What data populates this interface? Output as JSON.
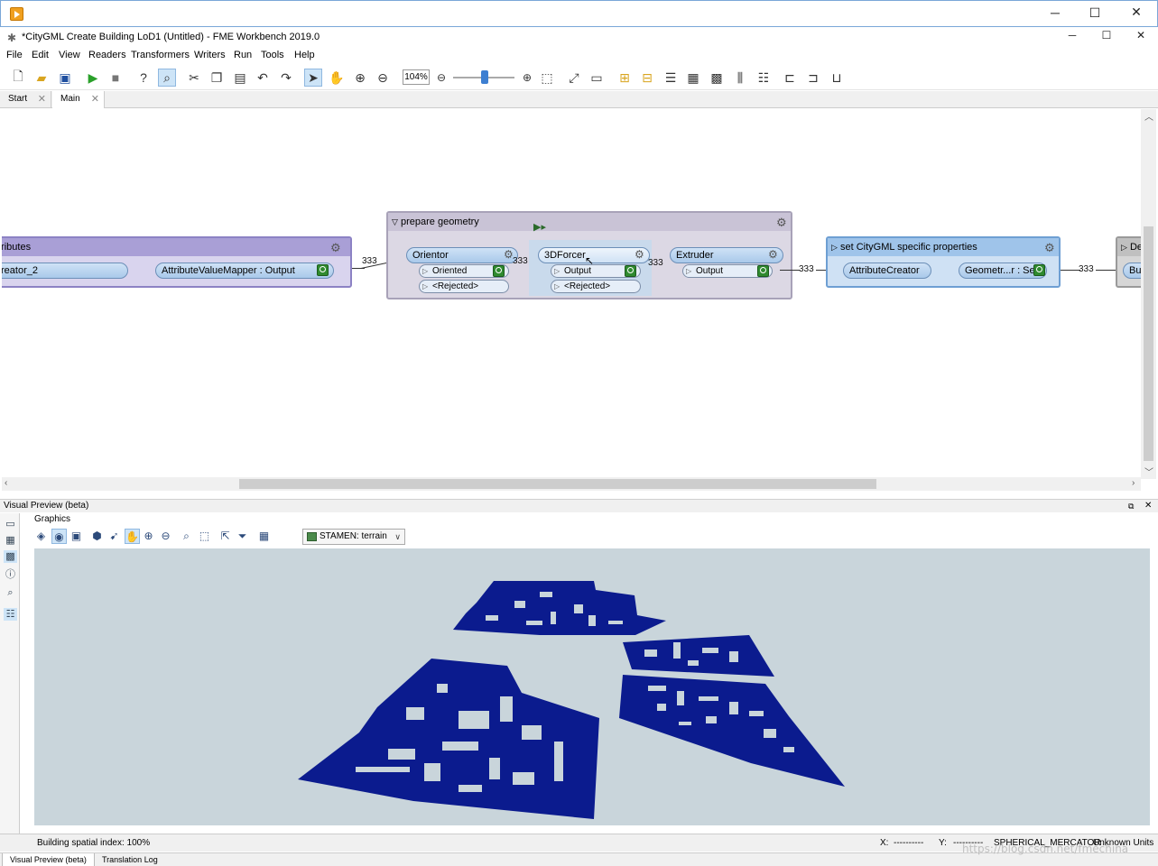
{
  "window": {
    "title": "*CityGML Create Building LoD1 (Untitled) - FME Workbench 2019.0"
  },
  "menu": [
    "File",
    "Edit",
    "View",
    "Readers",
    "Transformers",
    "Writers",
    "Run",
    "Tools",
    "Help"
  ],
  "toolbar": {
    "zoom": "104%"
  },
  "tabs": [
    {
      "label": "Start"
    },
    {
      "label": "Main"
    }
  ],
  "canvas": {
    "left_bookmark": {
      "title": "tributes",
      "item1": "reator_2",
      "item2": "AttributeValueMapper : Output",
      "count": "333"
    },
    "prepare": {
      "title": "prepare geometry",
      "orientor": {
        "name": "Orientor",
        "port1": "Oriented",
        "port2": "<Rejected>"
      },
      "forcer": {
        "name": "3DForcer",
        "port1": "Output",
        "port2": "<Rejected>"
      },
      "extruder": {
        "name": "Extruder",
        "port1": "Output"
      },
      "count1": "333",
      "count2": "333"
    },
    "citygml": {
      "title": "set CityGML specific properties",
      "creator": "AttributeCreator",
      "setter": "Geometr...r : Set",
      "count_in": "333",
      "count_out": "333"
    },
    "right_bookmark": {
      "title": "De",
      "item": "Bu"
    }
  },
  "preview": {
    "header": "Visual Preview (beta)",
    "graphics_label": "Graphics",
    "basemap": "STAMEN: terrain",
    "status": "Building spatial index: 100%",
    "x_label": "X:",
    "x_value": "----------",
    "y_label": "Y:",
    "y_value": "----------",
    "crs": "SPHERICAL_MERCATOR",
    "units": "Unknown Units"
  },
  "bottom_tabs": [
    "Visual Preview (beta)",
    "Translation Log"
  ],
  "watermark": "https://blog.csdn.net/fmechina",
  "colors": {
    "purple_bookmark": "#a99fd6",
    "gray_bookmark": "#d9d4e6",
    "blue_bookmark": "#9fc4ea",
    "buildings": "#0b1b8e",
    "viewport_bg": "#c9d5db"
  }
}
